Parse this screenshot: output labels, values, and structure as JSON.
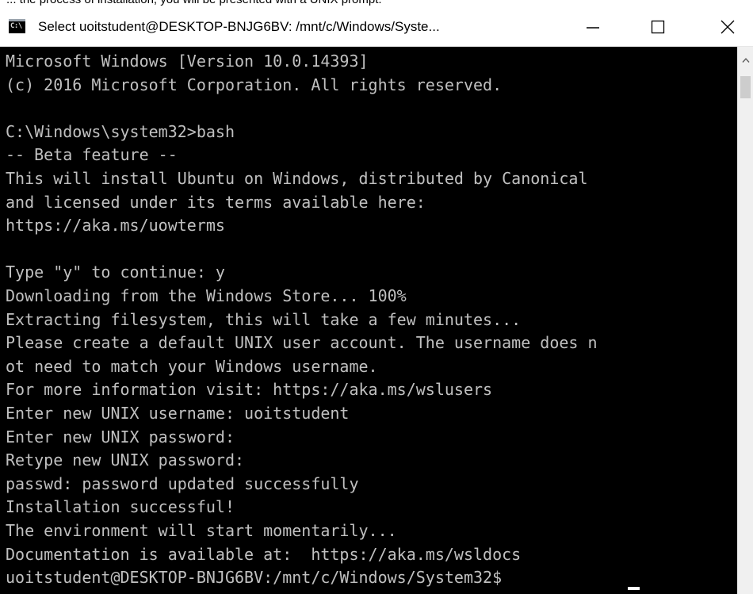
{
  "caption": {
    "text": "... the process of installation, you will be presented with a UNIX prompt."
  },
  "window": {
    "title": "Select uoitstudent@DESKTOP-BNJG6BV: /mnt/c/Windows/Syste...",
    "icon_label": "C:\\",
    "icon": "console-app-icon"
  },
  "controls": {
    "minimize_icon": "minimize-icon",
    "maximize_icon": "maximize-icon",
    "close_icon": "close-icon"
  },
  "terminal": {
    "lines": [
      "Microsoft Windows [Version 10.0.14393]",
      "(c) 2016 Microsoft Corporation. All rights reserved.",
      "",
      "C:\\Windows\\system32>bash",
      "-- Beta feature --",
      "This will install Ubuntu on Windows, distributed by Canonical",
      "and licensed under its terms available here:",
      "https://aka.ms/uowterms",
      "",
      "Type \"y\" to continue: y",
      "Downloading from the Windows Store... 100%",
      "Extracting filesystem, this will take a few minutes...",
      "Please create a default UNIX user account. The username does n",
      "ot need to match your Windows username.",
      "For more information visit: https://aka.ms/wslusers",
      "Enter new UNIX username: uoitstudent",
      "Enter new UNIX password:",
      "Retype new UNIX password:",
      "passwd: password updated successfully",
      "Installation successful!",
      "The environment will start momentarily...",
      "Documentation is available at:  https://aka.ms/wsldocs",
      "uoitstudent@DESKTOP-BNJG6BV:/mnt/c/Windows/System32$ "
    ],
    "text_color": "#c0c0c0",
    "background": "#000000"
  },
  "scrollbar": {
    "up_icon": "scroll-up-arrow-icon"
  }
}
